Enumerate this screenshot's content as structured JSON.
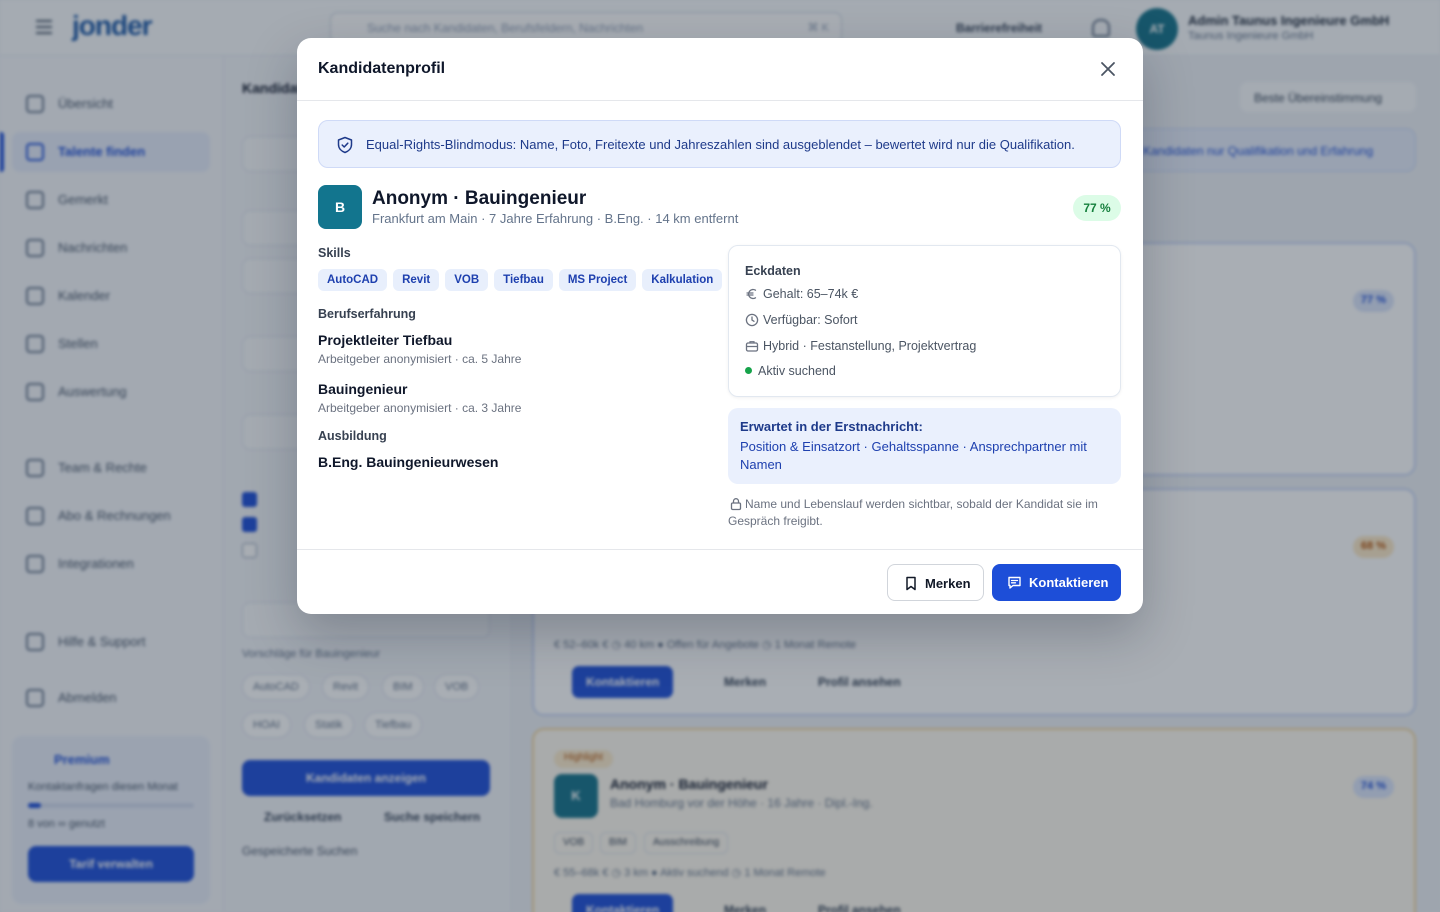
{
  "app": {
    "logo": "jonder",
    "search_placeholder": "Suche nach Kandidaten, Berufsfeldern, Nachrichten",
    "search_shortcut": "⌘ K",
    "accessibility_label": "Barrierefreiheit",
    "account_initials": "AT",
    "account_name": "Admin Taunus Ingenieure GmbH",
    "account_company": "Taunus Ingenieure GmbH"
  },
  "sidebar": {
    "items": [
      {
        "label": "Übersicht"
      },
      {
        "label": "Talente finden"
      },
      {
        "label": "Gemerkt"
      },
      {
        "label": "Nachrichten"
      },
      {
        "label": "Kalender"
      },
      {
        "label": "Stellen"
      },
      {
        "label": "Auswertung"
      },
      {
        "label": "Team & Rechte"
      },
      {
        "label": "Abo & Rechnungen"
      },
      {
        "label": "Integrationen"
      },
      {
        "label": "Hilfe & Support"
      },
      {
        "label": "Abmelden"
      }
    ],
    "premium": {
      "title": "Premium",
      "subtitle": "Kontaktanfragen diesen Monat",
      "progress": 0.08,
      "count": "8 von ∞ genutzt",
      "cta": "Tarif verwalten"
    }
  },
  "filters": {
    "title": "Kandidaten",
    "suggest_label": "Vorschläge für Bauingenieur",
    "chips": [
      "AutoCAD",
      "Revit",
      "BIM",
      "VOB",
      "HOAI",
      "Statik",
      "Tiefbau"
    ],
    "show_button": "Kandidaten anzeigen",
    "reset": "Zurücksetzen",
    "save_search": "Suche speichern",
    "saved_searches": "Gespeicherte Suchen"
  },
  "results": {
    "sort": "Beste Übereinstimmung",
    "info": "Kandidaten nur Qualifikation und Erfahrung",
    "card2_badge": "68 %",
    "card3_tag": "Highlight",
    "card3_name": "Anonym · Bauingenieur",
    "card3_sub": "Bad Homburg vor der Höhe · 16 Jahre · Dipl.-Ing.",
    "card3_badge": "74 %",
    "card3_chips": [
      "VOB",
      "BIM",
      "Ausschreibung"
    ],
    "card3_meta": "€ 55–68k €   ◷ 3 km   ● Aktiv suchend   ◷ 1 Monat   Remote",
    "card_contact": "Kontaktieren",
    "card_save": "Merken",
    "card_profile": "Profil ansehen",
    "card1_badge": "77 %",
    "card2_meta": "€ 52–60k €   ◷ 40 km   ● Offen für Angebote   ◷ 1 Monat   Remote"
  },
  "modal": {
    "title": "Kandidatenprofil",
    "notice": "Equal-Rights-Blindmodus: Name, Foto, Freitexte und Jahreszahlen sind ausgeblendet – bewertet wird nur die Qualifikation.",
    "candidate": {
      "initial": "B",
      "name": "Anonym · Bauingenieur",
      "subtitle": "Frankfurt am Main · 7 Jahre Erfahrung · B.Eng. · 14 km entfernt",
      "match": "77 %"
    },
    "skills_label": "Skills",
    "skills": [
      "AutoCAD",
      "Revit",
      "VOB",
      "Tiefbau",
      "MS Project",
      "Kalkulation"
    ],
    "experience_label": "Berufserfahrung",
    "experience": [
      {
        "title": "Projektleiter Tiefbau",
        "detail": "Arbeitgeber anonymisiert · ca. 5 Jahre"
      },
      {
        "title": "Bauingenieur",
        "detail": "Arbeitgeber anonymisiert · ca. 3 Jahre"
      }
    ],
    "education_label": "Ausbildung",
    "education": "B.Eng. Bauingenieurwesen",
    "facts_label": "Eckdaten",
    "facts": {
      "salary": "Gehalt: 65–74k €",
      "availability": "Verfügbar: Sofort",
      "work": "Hybrid · Festanstellung, Projektvertrag",
      "status": "Aktiv suchend"
    },
    "expect_title": "Erwartet in der Erstnachricht:",
    "expect_body": "Position & Einsatzort · Gehaltsspanne · Ansprechpartner mit Namen",
    "lock_note": "Name und Lebenslauf werden sichtbar, sobald der Kandidat sie im Gespräch freigibt.",
    "save_label": "Merken",
    "contact_label": "Kontaktieren",
    "colors": {
      "primary": "#1d4ed8",
      "avatar": "#12758e",
      "match_bg": "#dcfce7",
      "match_fg": "#15803d"
    }
  }
}
